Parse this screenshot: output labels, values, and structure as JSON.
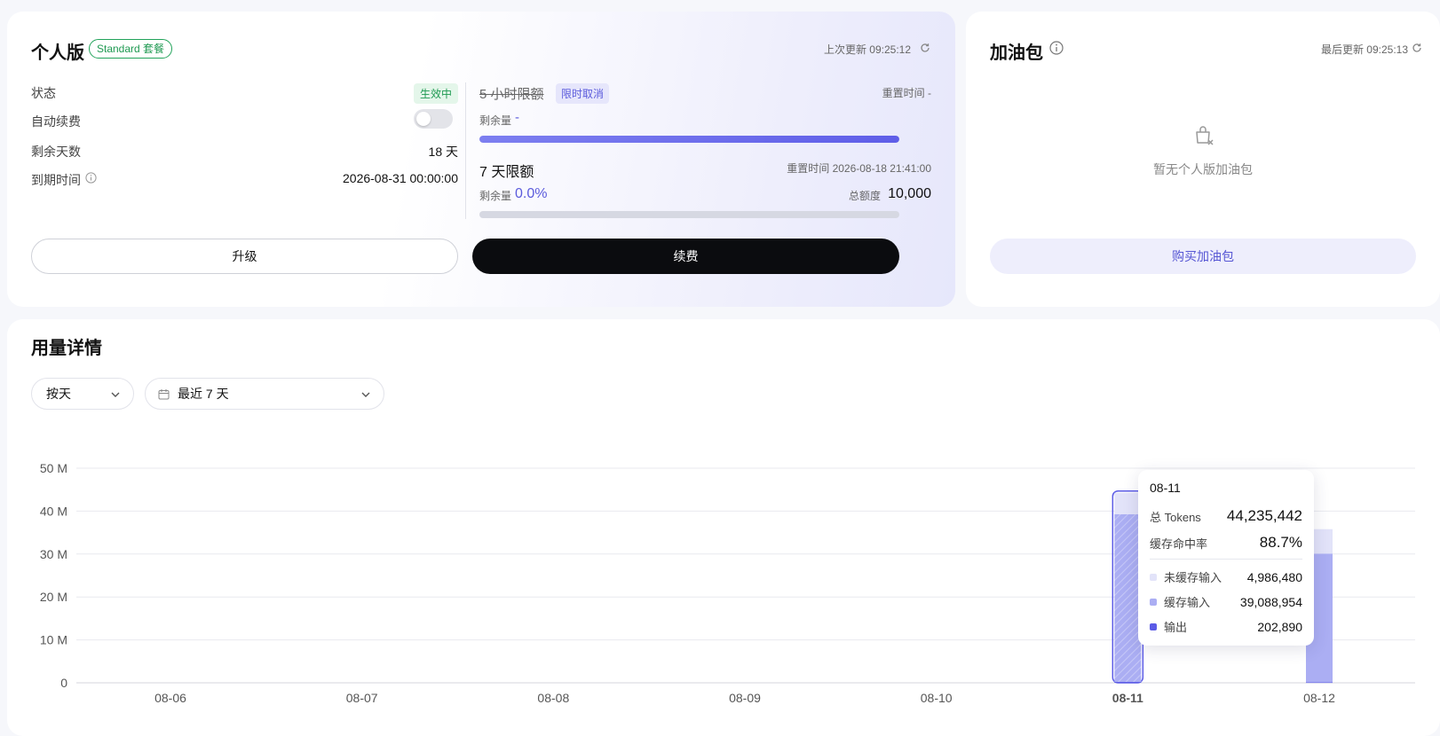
{
  "plan": {
    "title": "个人版",
    "badge": "Standard 套餐",
    "last_update": "上次更新 09:25:12",
    "status_label": "状态",
    "status_value": "生效中",
    "auto_renew_label": "自动续费",
    "auto_renew_on": false,
    "days_left_label": "剩余天数",
    "days_left_value": "18 天",
    "expire_label": "到期时间",
    "expire_value": "2026-08-31 00:00:00",
    "limit5h": {
      "title": "5 小时限额",
      "tag": "限时取消",
      "reset": "重置时间 -",
      "remaining_label": "剩余量",
      "remaining_value": "-",
      "progress_fraction": 1.0
    },
    "limit7d": {
      "title": "7 天限额",
      "reset": "重置时间 2026-08-18 21:41:00",
      "remaining_label": "剩余量",
      "remaining_value": "0.0%",
      "total_label": "总额度",
      "total_value": "10,000",
      "progress_fraction": 0.0
    },
    "upgrade_button": "升级",
    "renew_button": "续费"
  },
  "addon": {
    "title": "加油包",
    "last_update": "最后更新 09:25:13",
    "empty_text": "暂无个人版加油包",
    "buy_button": "购买加油包"
  },
  "usage": {
    "title": "用量详情",
    "granularity": "按天",
    "range": "最近 7 天"
  },
  "colors": {
    "accent": "#5b5bdc",
    "uncached_input": "#e2e3f9",
    "cached_input": "#abaef3",
    "output": "#5b5be6"
  },
  "chart_data": {
    "type": "bar",
    "stacked": true,
    "categories": [
      "08-06",
      "08-07",
      "08-08",
      "08-09",
      "08-10",
      "08-11",
      "08-12"
    ],
    "y_ticks": [
      "0",
      "10 M",
      "20 M",
      "30 M",
      "40 M",
      "50 M"
    ],
    "ylim": [
      0,
      50000000
    ],
    "grid": true,
    "highlighted": "08-11",
    "series": [
      {
        "name": "输出",
        "color": "#5b5be6",
        "values": [
          0,
          0,
          0,
          0,
          0,
          202890,
          100000
        ]
      },
      {
        "name": "缓存输入",
        "color": "#abaef3",
        "values": [
          0,
          0,
          0,
          0,
          0,
          39088954,
          30000000
        ]
      },
      {
        "name": "未缓存输入",
        "color": "#e2e3f9",
        "values": [
          0,
          0,
          0,
          0,
          0,
          4986480,
          5700000
        ]
      }
    ],
    "tooltip": {
      "date": "08-11",
      "total_label": "总 Tokens",
      "total_value": "44,235,442",
      "hit_label": "缓存命中率",
      "hit_value": "88.7%",
      "rows": [
        {
          "label": "未缓存输入",
          "value": "4,986,480",
          "color": "#e2e3f9"
        },
        {
          "label": "缓存输入",
          "value": "39,088,954",
          "color": "#abaef3"
        },
        {
          "label": "输出",
          "value": "202,890",
          "color": "#5b5be6"
        }
      ]
    }
  }
}
